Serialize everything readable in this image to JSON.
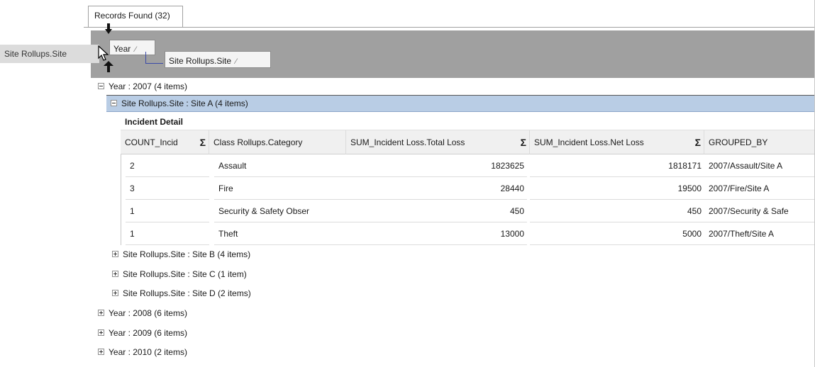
{
  "tab": {
    "label": "Records Found (32)"
  },
  "group_panel": {
    "chips": [
      {
        "label": "Year",
        "sort": "⁄"
      },
      {
        "label": "Site Rollups.Site",
        "sort": "⁄"
      }
    ],
    "drag_ghost": "Site Rollups.Site"
  },
  "tree": {
    "year_2007": "Year : 2007 (4 items)",
    "site_a": "Site Rollups.Site : Site A (4 items)",
    "detail_title": "Incident Detail",
    "site_b": "Site Rollups.Site : Site B (4 items)",
    "site_c": "Site Rollups.Site : Site C (1 item)",
    "site_d": "Site Rollups.Site : Site D (2 items)",
    "year_2008": "Year : 2008 (6 items)",
    "year_2009": "Year : 2009 (6 items)",
    "year_2010": "Year : 2010 (2 items)"
  },
  "table": {
    "headers": [
      {
        "label": "COUNT_Incid",
        "sigma": "Σ"
      },
      {
        "label": "Class Rollups.Category",
        "sigma": ""
      },
      {
        "label": "SUM_Incident Loss.Total Loss",
        "sigma": "Σ"
      },
      {
        "label": "SUM_Incident Loss.Net Loss",
        "sigma": "Σ"
      },
      {
        "label": "GROUPED_BY",
        "sigma": ""
      }
    ],
    "rows": [
      [
        "2",
        "Assault",
        "1823625",
        "1818171",
        "2007/Assault/Site A"
      ],
      [
        "3",
        "Fire",
        "28440",
        "19500",
        "2007/Fire/Site A"
      ],
      [
        "1",
        "Security & Safety Obser",
        "450",
        "450",
        "2007/Security & Safe"
      ],
      [
        "1",
        "Theft",
        "13000",
        "5000",
        "2007/Theft/Site A"
      ]
    ]
  },
  "colors": {
    "group_area": "#a0a0a0",
    "selected_row": "#b9cde5",
    "connector": "#3b4aa8"
  }
}
